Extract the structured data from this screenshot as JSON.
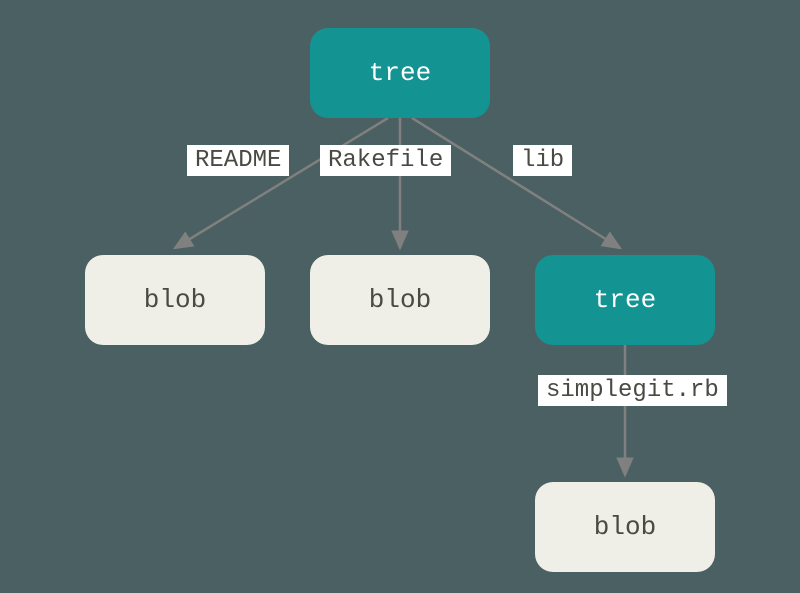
{
  "diagram": {
    "nodes": {
      "root": "tree",
      "blob_readme": "blob",
      "blob_rakefile": "blob",
      "lib_tree": "tree",
      "blob_simplegit": "blob"
    },
    "edges": {
      "readme": "README",
      "rakefile": "Rakefile",
      "lib": "lib",
      "simplegit": "simplegit.rb"
    }
  },
  "colors": {
    "background": "#4A6062",
    "tree_fill": "#149393",
    "blob_fill": "#EFEFE7",
    "arrow": "#808080",
    "text_dark": "#4A4A44"
  }
}
